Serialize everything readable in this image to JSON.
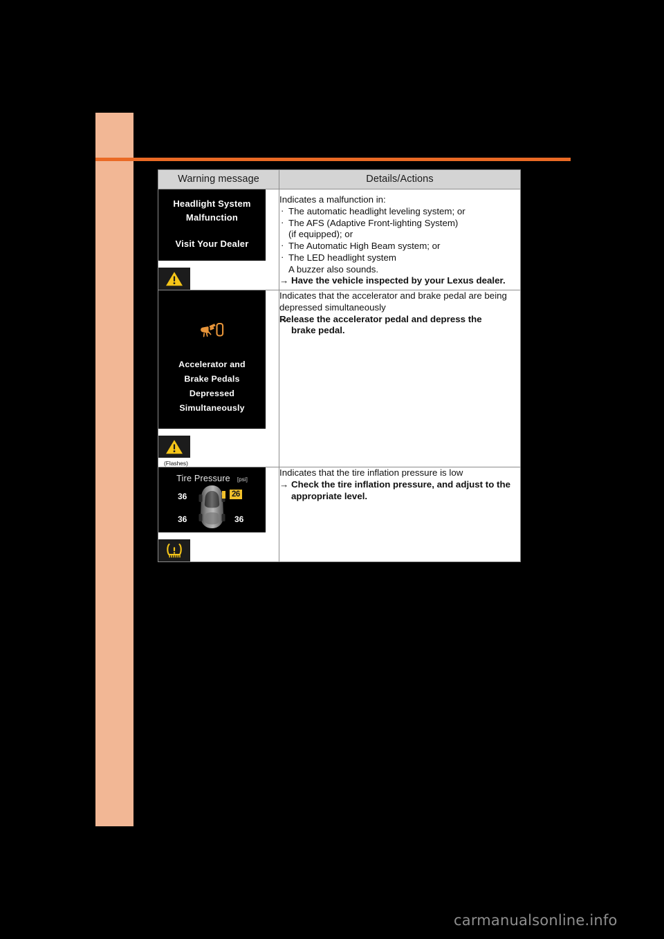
{
  "page": {
    "accent_color": "#ea6a25",
    "side_tab_color": "#f2b795",
    "background_color": "#000000",
    "watermark": "carmanualsonline.info"
  },
  "table": {
    "headers": {
      "warning_message": "Warning message",
      "details_actions": "Details/Actions"
    },
    "rows": [
      {
        "id": "headlight-system-malfunction",
        "mid_screen": {
          "lines": [
            "Headlight System",
            "Malfunction",
            "Visit Your Dealer"
          ]
        },
        "telltale_icon": "master-warning-triangle-icon",
        "telltale_note": "",
        "details": {
          "intro": "Indicates a malfunction in:",
          "bullets": [
            "The automatic headlight leveling system; or",
            "The AFS (Adaptive Front-lighting System)",
            "The Automatic High Beam system; or",
            "The LED headlight system"
          ],
          "bullet_sub_2": "(if equipped); or",
          "bullet_sub_4": "A buzzer also sounds.",
          "arrow": "→",
          "action": "Have the vehicle inspected by your Lexus dealer."
        }
      },
      {
        "id": "accelerator-and-brake-pedals-depressed",
        "mid_screen": {
          "icon": "brake-override-pedal-icon",
          "icon_color": "#e8953a",
          "lines": [
            "Accelerator and",
            "Brake Pedals",
            "Depressed",
            "Simultaneously"
          ]
        },
        "telltale_icon": "master-warning-triangle-icon",
        "telltale_note": "(Flashes)",
        "details": {
          "intro_line1": "Indicates that the accelerator and brake pedal are being",
          "intro_line2": "depressed simultaneously",
          "arrow": "→",
          "action_line1": "Release the accelerator pedal and depress the",
          "action_line2": "brake pedal."
        }
      },
      {
        "id": "tire-pressure-low",
        "mid_screen": {
          "title": "Tire Pressure",
          "unit": "[psi]",
          "tires": {
            "front_left": "36",
            "front_right": "26",
            "rear_left": "36",
            "rear_right": "36"
          },
          "highlight_color": "#f2c12a",
          "alert_position": "front_right"
        },
        "telltale_icon": "tire-pressure-warning-icon",
        "telltale_note": "",
        "details": {
          "intro": "Indicates that the tire inflation pressure is low",
          "arrow": "→",
          "action_line1": "Check the tire inflation pressure, and adjust to the",
          "action_line2": "appropriate level."
        }
      }
    ]
  }
}
